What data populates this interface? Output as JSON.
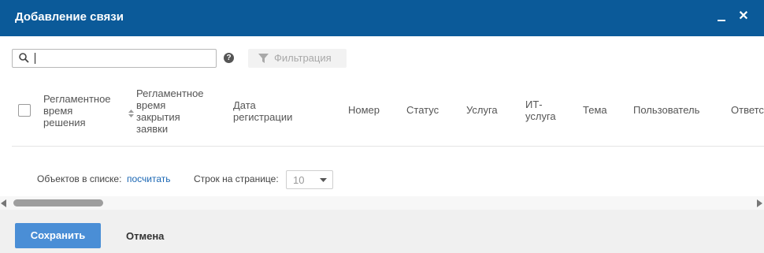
{
  "dialog": {
    "title": "Добавление связи",
    "minimize_icon": "minimize-icon",
    "close_icon": "close-icon",
    "close_glyph": "✕"
  },
  "toolbar": {
    "search_value": "",
    "search_icon": "search-icon",
    "help_icon": "help-icon",
    "help_glyph": "?",
    "filter_label": "Фильтрация",
    "filter_icon": "funnel-icon"
  },
  "table": {
    "columns": [
      "Регламентное время решения",
      "Регламентное время закрытия заявки",
      "Дата регистрации",
      "Номер",
      "Статус",
      "Услуга",
      "ИТ-услуга",
      "Тема",
      "Пользователь",
      "Ответс"
    ],
    "column_lines": {
      "c0": [
        "Регламентное",
        "время",
        "решения"
      ],
      "c1": [
        "Регламентное",
        "время",
        "закрытия",
        "заявки"
      ],
      "c2": [
        "Дата",
        "регистрации"
      ],
      "c6": [
        "ИТ-",
        "услуга"
      ]
    },
    "sorted_column_index": 1,
    "rows": []
  },
  "pager": {
    "count_label": "Объектов в списке:",
    "count_link": "посчитать",
    "rows_label": "Строк на странице:",
    "rows_value": "10"
  },
  "footer": {
    "save_label": "Сохранить",
    "cancel_label": "Отмена"
  },
  "colors": {
    "titlebar": "#0b5a99",
    "primary_button": "#4a8ed6",
    "link": "#1a66b3",
    "footer_bg": "#f0f0f0"
  }
}
